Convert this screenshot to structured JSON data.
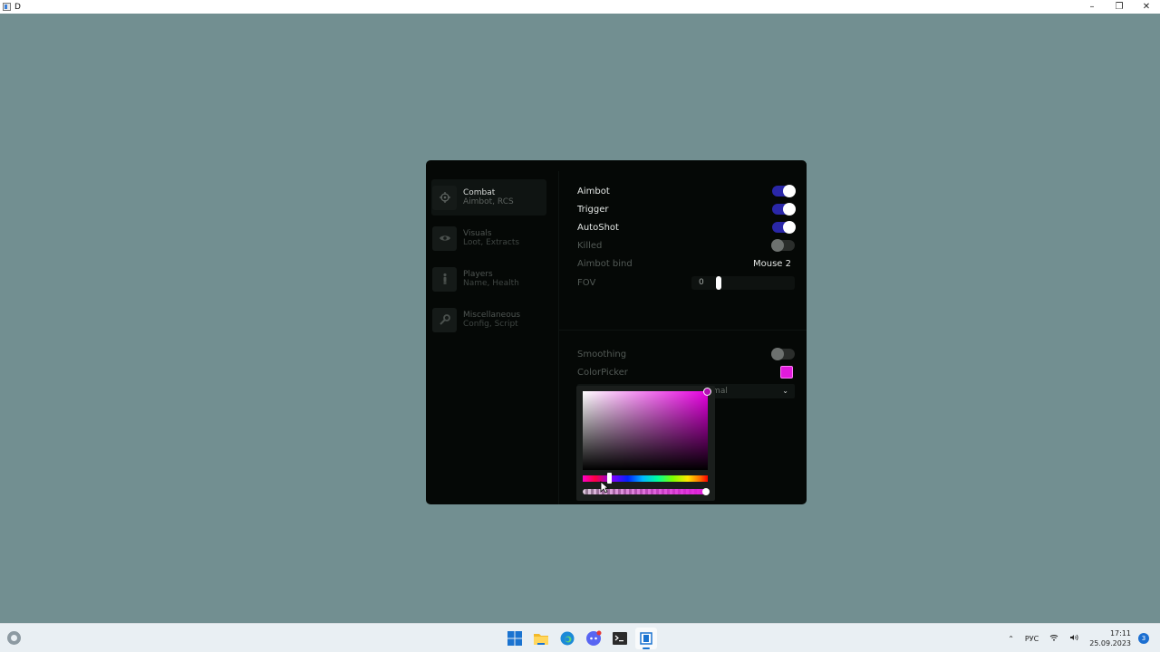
{
  "window": {
    "title": "D",
    "controls": {
      "minimize": "–",
      "restore": "❐",
      "close": "✕"
    }
  },
  "sidebar": {
    "items": [
      {
        "title": "Combat",
        "subtitle": "Aimbot, RCS",
        "icon": "crosshair-icon",
        "active": true
      },
      {
        "title": "Visuals",
        "subtitle": "Loot, Extracts",
        "icon": "eye-icon",
        "active": false
      },
      {
        "title": "Players",
        "subtitle": "Name, Health",
        "icon": "person-icon",
        "active": false
      },
      {
        "title": "Miscellaneous",
        "subtitle": "Config, Script",
        "icon": "gear-icon",
        "active": false
      }
    ]
  },
  "settings": {
    "aimbot": {
      "label": "Aimbot",
      "on": true
    },
    "trigger": {
      "label": "Trigger",
      "on": true
    },
    "autoshot": {
      "label": "AutoShot",
      "on": true
    },
    "killed": {
      "label": "Killed",
      "on": false
    },
    "aimbot_bind": {
      "label": "Aimbot bind",
      "value": "Mouse 2"
    },
    "fov": {
      "label": "FOV",
      "value": "0"
    },
    "smoothing": {
      "label": "Smoothing",
      "on": false
    },
    "colorpicker": {
      "label": "ColorPicker",
      "color": "#e21bdc"
    },
    "mode_select": {
      "value": "ormal"
    }
  },
  "color_picker_popup": {
    "hue_color": "#e600e0",
    "alpha": 1.0
  },
  "taskbar": {
    "apps": [
      "windows-start-icon",
      "file-explorer-icon",
      "edge-icon",
      "discord-icon",
      "terminal-icon",
      "active-app-icon"
    ],
    "language": "РУС",
    "time": "17:11",
    "date": "25.09.2023",
    "notifications": "3"
  }
}
